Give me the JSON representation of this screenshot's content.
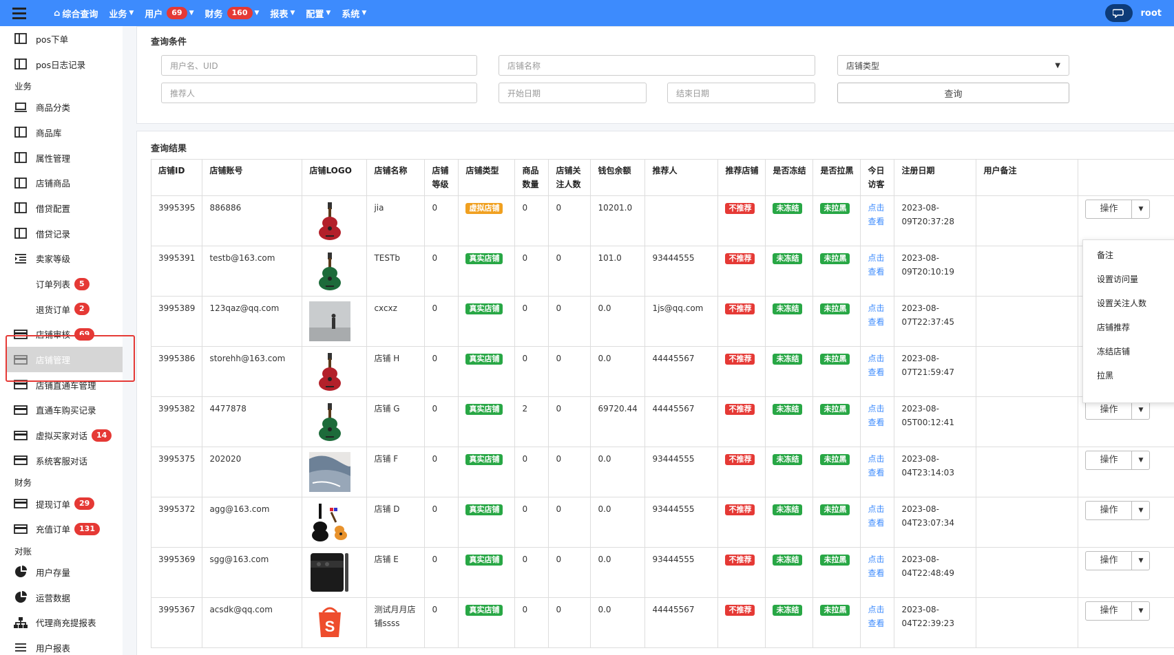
{
  "topnav": {
    "items": [
      {
        "label": "综合查询",
        "badge": null,
        "caret": false
      },
      {
        "label": "业务",
        "badge": null,
        "caret": true
      },
      {
        "label": "用户",
        "badge": "69",
        "caret": true
      },
      {
        "label": "财务",
        "badge": "160",
        "caret": true
      },
      {
        "label": "报表",
        "badge": null,
        "caret": true
      },
      {
        "label": "配置",
        "badge": null,
        "caret": true
      },
      {
        "label": "系统",
        "badge": null,
        "caret": true
      }
    ],
    "user": "root"
  },
  "sidebar": {
    "items": [
      {
        "kind": "item",
        "label": "pos下单",
        "icon": "table-icon",
        "badge": null
      },
      {
        "kind": "item",
        "label": "pos日志记录",
        "icon": "table-icon",
        "badge": null
      },
      {
        "kind": "section",
        "label": "业务"
      },
      {
        "kind": "item",
        "label": "商品分类",
        "icon": "laptop-icon",
        "badge": null
      },
      {
        "kind": "item",
        "label": "商品库",
        "icon": "table-icon",
        "badge": null
      },
      {
        "kind": "item",
        "label": "属性管理",
        "icon": "table-icon",
        "badge": null
      },
      {
        "kind": "item",
        "label": "店铺商品",
        "icon": "table-icon",
        "badge": null
      },
      {
        "kind": "item",
        "label": "借贷配置",
        "icon": "table-icon",
        "badge": null
      },
      {
        "kind": "item",
        "label": "借贷记录",
        "icon": "table-icon",
        "badge": null
      },
      {
        "kind": "item",
        "label": "卖家等级",
        "icon": "list-indent-icon",
        "badge": null
      },
      {
        "kind": "sub",
        "label": "订单列表",
        "icon": null,
        "badge": "5"
      },
      {
        "kind": "sub",
        "label": "退货订单",
        "icon": null,
        "badge": "2"
      },
      {
        "kind": "item",
        "label": "店铺审核",
        "icon": "card-icon",
        "badge": "69"
      },
      {
        "kind": "active",
        "label": "店铺管理",
        "icon": "card-icon",
        "badge": null
      },
      {
        "kind": "item",
        "label": "店铺直通车管理",
        "icon": "card-icon",
        "badge": null
      },
      {
        "kind": "item",
        "label": "直通车购买记录",
        "icon": "card-icon",
        "badge": null
      },
      {
        "kind": "item",
        "label": "虚拟买家对话",
        "icon": "card-icon",
        "badge": "14"
      },
      {
        "kind": "item",
        "label": "系统客服对话",
        "icon": "card-icon",
        "badge": null
      },
      {
        "kind": "section",
        "label": "财务"
      },
      {
        "kind": "item",
        "label": "提现订单",
        "icon": "card-icon",
        "badge": "29"
      },
      {
        "kind": "item",
        "label": "充值订单",
        "icon": "card-icon",
        "badge": "131"
      },
      {
        "kind": "section",
        "label": "对账"
      },
      {
        "kind": "item",
        "label": "用户存量",
        "icon": "pie-icon",
        "badge": null
      },
      {
        "kind": "item",
        "label": "运营数据",
        "icon": "pie-icon",
        "badge": null
      },
      {
        "kind": "item",
        "label": "代理商充提报表",
        "icon": "sitemap-icon",
        "badge": null
      },
      {
        "kind": "item",
        "label": "用户报表",
        "icon": "bars-icon",
        "badge": null
      }
    ]
  },
  "query": {
    "title": "查询条件",
    "user_placeholder": "用户名、UID",
    "shop_name_placeholder": "店铺名称",
    "shop_type_selected": "店铺类型",
    "referrer_placeholder": "推荐人",
    "start_date_placeholder": "开始日期",
    "end_date_placeholder": "结束日期",
    "query_button": "查询"
  },
  "results": {
    "title": "查询结果",
    "columns": [
      "店铺ID",
      "店铺账号",
      "店铺LOGO",
      "店铺名称",
      "店铺等级",
      "店铺类型",
      "商品数量",
      "店铺关注人数",
      "钱包余额",
      "推荐人",
      "推荐店铺",
      "是否冻结",
      "是否拉黑",
      "今日访客",
      "注册日期",
      "用户备注",
      ""
    ],
    "op_label": "操作",
    "visit_label": "点击查看",
    "rows": [
      {
        "id": "3995395",
        "account": "886886",
        "logo": "guitar-red",
        "name": "jia",
        "level": "0",
        "type": "虚拟店铺",
        "type_color": "orange",
        "goods": "0",
        "followers": "0",
        "wallet": "10201.0",
        "referrer": "",
        "recommend": "不推荐",
        "frozen": "未冻结",
        "black": "未拉黑",
        "date": "2023-08-09T20:37:28",
        "remark": ""
      },
      {
        "id": "3995391",
        "account": "testb@163.com",
        "logo": "guitar-green",
        "name": "TESTb",
        "level": "0",
        "type": "真实店铺",
        "type_color": "green",
        "goods": "0",
        "followers": "0",
        "wallet": "101.0",
        "referrer": "93444555",
        "recommend": "不推荐",
        "frozen": "未冻结",
        "black": "未拉黑",
        "date": "2023-08-09T20:10:19",
        "remark": ""
      },
      {
        "id": "3995389",
        "account": "123qaz@qq.com",
        "logo": "photo-fog",
        "name": "cxcxz",
        "level": "0",
        "type": "真实店铺",
        "type_color": "green",
        "goods": "0",
        "followers": "0",
        "wallet": "0.0",
        "referrer": "1js@qq.com",
        "recommend": "不推荐",
        "frozen": "未冻结",
        "black": "未拉黑",
        "date": "2023-08-07T22:37:45",
        "remark": ""
      },
      {
        "id": "3995386",
        "account": "storehh@163.com",
        "logo": "guitar-red",
        "name": "店铺 H",
        "level": "0",
        "type": "真实店铺",
        "type_color": "green",
        "goods": "0",
        "followers": "0",
        "wallet": "0.0",
        "referrer": "44445567",
        "recommend": "不推荐",
        "frozen": "未冻结",
        "black": "未拉黑",
        "date": "2023-08-07T21:59:47",
        "remark": ""
      },
      {
        "id": "3995382",
        "account": "4477878",
        "logo": "guitar-green",
        "name": "店铺 G",
        "level": "0",
        "type": "真实店铺",
        "type_color": "green",
        "goods": "2",
        "followers": "0",
        "wallet": "69720.44",
        "referrer": "44445567",
        "recommend": "不推荐",
        "frozen": "未冻结",
        "black": "未拉黑",
        "date": "2023-08-05T00:12:41",
        "remark": ""
      },
      {
        "id": "3995375",
        "account": "202020",
        "logo": "photo-cloth",
        "name": "店铺 F",
        "level": "0",
        "type": "真实店铺",
        "type_color": "green",
        "goods": "0",
        "followers": "0",
        "wallet": "0.0",
        "referrer": "93444555",
        "recommend": "不推荐",
        "frozen": "未冻结",
        "black": "未拉黑",
        "date": "2023-08-04T23:14:03",
        "remark": ""
      },
      {
        "id": "3995372",
        "account": "agg@163.com",
        "logo": "ukulele",
        "name": "店铺 D",
        "level": "0",
        "type": "真实店铺",
        "type_color": "green",
        "goods": "0",
        "followers": "0",
        "wallet": "0.0",
        "referrer": "93444555",
        "recommend": "不推荐",
        "frozen": "未冻结",
        "black": "未拉黑",
        "date": "2023-08-04T23:07:34",
        "remark": ""
      },
      {
        "id": "3995369",
        "account": "sgg@163.com",
        "logo": "phone",
        "name": "店铺 E",
        "level": "0",
        "type": "真实店铺",
        "type_color": "green",
        "goods": "0",
        "followers": "0",
        "wallet": "0.0",
        "referrer": "93444555",
        "recommend": "不推荐",
        "frozen": "未冻结",
        "black": "未拉黑",
        "date": "2023-08-04T22:48:49",
        "remark": ""
      },
      {
        "id": "3995367",
        "account": "acsdk@qq.com",
        "logo": "shopee",
        "name": "测试月月店铺ssss",
        "level": "0",
        "type": "真实店铺",
        "type_color": "green",
        "goods": "0",
        "followers": "0",
        "wallet": "0.0",
        "referrer": "44445567",
        "recommend": "不推荐",
        "frozen": "未冻结",
        "black": "未拉黑",
        "date": "2023-08-04T22:39:23",
        "remark": ""
      }
    ]
  },
  "dropdown": {
    "items": [
      "备注",
      "设置访问量",
      "设置关注人数",
      "店铺推荐",
      "冻结店铺",
      "拉黑"
    ]
  },
  "colors": {
    "topbar": "#3d8bfd",
    "badge": "#e53935",
    "tag_green": "#28a745",
    "tag_orange": "#f0a020",
    "link": "#3d8bfd",
    "highlight_box": "#e53935"
  }
}
